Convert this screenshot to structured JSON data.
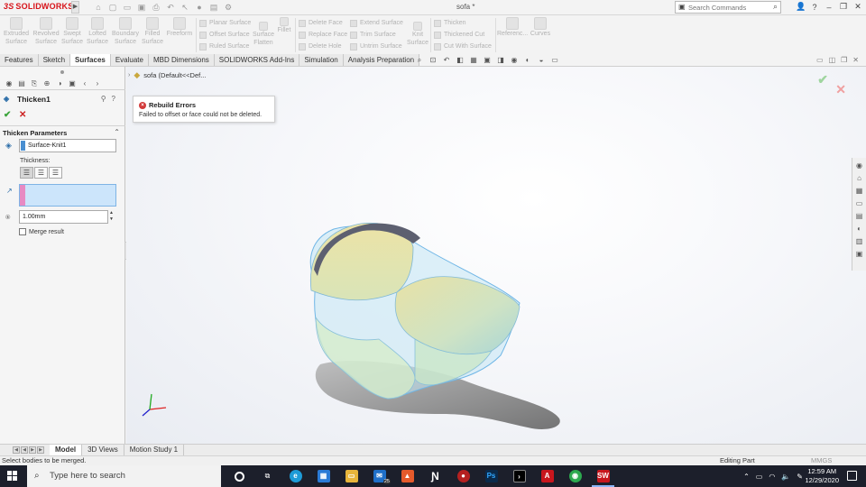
{
  "app": {
    "logo": "SOLIDWORKS",
    "logo_prefix": "3S",
    "doc_title": "sofa *"
  },
  "search": {
    "placeholder": "Search Commands"
  },
  "window_controls": [
    "?",
    "–",
    "❐",
    "✕"
  ],
  "command_manager": {
    "big_buttons": [
      "Extruded Surface",
      "Revolved Surface",
      "Swept Surface",
      "Lofted Surface",
      "Boundary Surface",
      "Filled Surface",
      "Freeform"
    ],
    "col1": [
      "Planar Surface",
      "Offset Surface",
      "Ruled Surface"
    ],
    "flatten": "Surface Flatten",
    "fillet": "Fillet",
    "col2": [
      "Delete Face",
      "Replace Face",
      "Delete Hole"
    ],
    "col3": [
      "Extend Surface",
      "Trim Surface",
      "Untrim Surface"
    ],
    "knit": "Knit Surface",
    "col4": [
      "Thicken",
      "Thickened Cut",
      "Cut With Surface"
    ],
    "reference": "Referenc...",
    "curves": "Curves"
  },
  "tabs": [
    "Features",
    "Sketch",
    "Surfaces",
    "Evaluate",
    "MBD Dimensions",
    "SOLIDWORKS Add-Ins",
    "Simulation",
    "Analysis Preparation"
  ],
  "active_tab": "Surfaces",
  "property_manager": {
    "title": "Thicken1",
    "group": "Thicken Parameters",
    "selection": "Surface-Knit1",
    "thickness_label": "Thickness:",
    "thickness_value": "1.00mm",
    "merge_label": "Merge result"
  },
  "graphics": {
    "tree_item": "sofa  (Default<<Def...",
    "error_title": "Rebuild Errors",
    "error_message": "Failed to offset or face could not be deleted."
  },
  "model_tabs": [
    "Model",
    "3D Views",
    "Motion Study 1"
  ],
  "status": {
    "left": "Select bodies to be merged.",
    "mid": "Editing Part",
    "units": "MMGS"
  },
  "taskbar": {
    "search_placeholder": "Type here to search",
    "mail_badge": "25",
    "time": "12:59 AM",
    "date": "12/29/2020"
  },
  "colors": {
    "accent": "#d7141a",
    "selection": "#cce5fb",
    "taskbar": "#1c1f2b"
  }
}
